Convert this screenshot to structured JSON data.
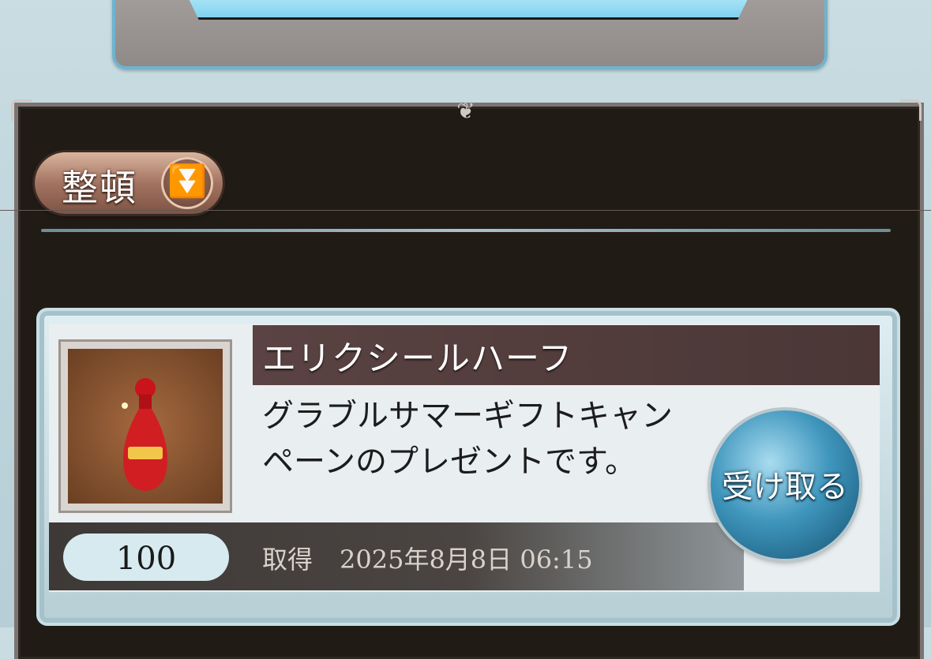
{
  "sort": {
    "label": "整頓",
    "icon": "double-chevron-down-icon"
  },
  "item": {
    "name": "エリクシールハーフ",
    "description": "グラブルサマーギフトキャンペーンのプレゼントです。",
    "quantity": "100",
    "acquired_label": "取得",
    "acquired_date": "2025年8月8日 06:15",
    "icon": "potion-icon",
    "receive_label": "受け取る"
  }
}
